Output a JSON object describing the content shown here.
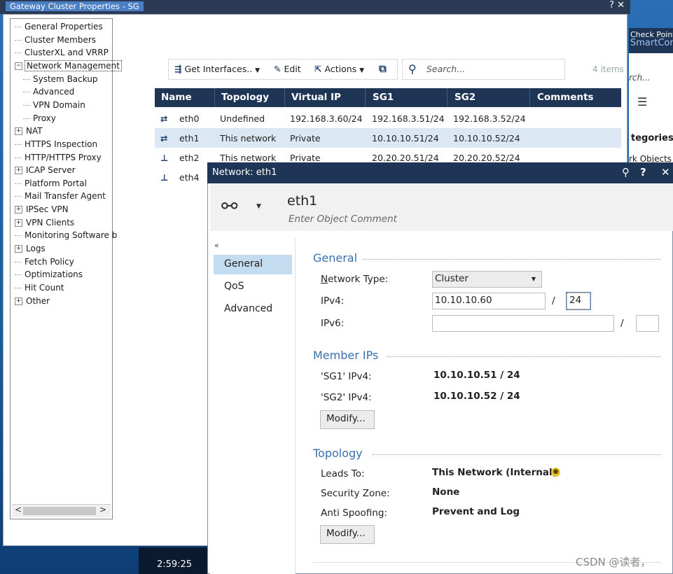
{
  "window": {
    "title": "Gateway Cluster Properties - SG",
    "title_buttons": "? ✕"
  },
  "tree": {
    "items": [
      {
        "label": "General Properties",
        "level": 0,
        "expander": ""
      },
      {
        "label": "Cluster Members",
        "level": 0,
        "expander": ""
      },
      {
        "label": "ClusterXL and VRRP",
        "level": 0,
        "expander": ""
      },
      {
        "label": "Network Management",
        "level": 0,
        "expander": "−",
        "selected": true
      },
      {
        "label": "System Backup",
        "level": 1,
        "expander": ""
      },
      {
        "label": "Advanced",
        "level": 1,
        "expander": ""
      },
      {
        "label": "VPN Domain",
        "level": 1,
        "expander": ""
      },
      {
        "label": "Proxy",
        "level": 1,
        "expander": ""
      },
      {
        "label": "NAT",
        "level": 0,
        "expander": "+"
      },
      {
        "label": "HTTPS Inspection",
        "level": 0,
        "expander": ""
      },
      {
        "label": "HTTP/HTTPS Proxy",
        "level": 0,
        "expander": ""
      },
      {
        "label": "ICAP Server",
        "level": 0,
        "expander": "+"
      },
      {
        "label": "Platform Portal",
        "level": 0,
        "expander": ""
      },
      {
        "label": "Mail Transfer Agent",
        "level": 0,
        "expander": ""
      },
      {
        "label": "IPSec VPN",
        "level": 0,
        "expander": "+"
      },
      {
        "label": "VPN Clients",
        "level": 0,
        "expander": "+"
      },
      {
        "label": "Monitoring Software b",
        "level": 0,
        "expander": ""
      },
      {
        "label": "Logs",
        "level": 0,
        "expander": "+"
      },
      {
        "label": "Fetch Policy",
        "level": 0,
        "expander": ""
      },
      {
        "label": "Optimizations",
        "level": 0,
        "expander": ""
      },
      {
        "label": "Hit Count",
        "level": 0,
        "expander": ""
      },
      {
        "label": "Other",
        "level": 0,
        "expander": "+"
      }
    ]
  },
  "toolbar": {
    "get_interfaces": "Get Interfaces..",
    "edit": "Edit",
    "actions": "Actions",
    "search_placeholder": "Search...",
    "items_count": "4 items"
  },
  "table": {
    "columns": [
      "Name",
      "Topology",
      "Virtual IP",
      "SG1",
      "SG2",
      "Comments"
    ],
    "rows": [
      {
        "name": "eth0",
        "topology": "Undefined",
        "vip": "192.168.3.60/24",
        "sg1": "192.168.3.51/24",
        "sg2": "192.168.3.52/24",
        "comments": ""
      },
      {
        "name": "eth1",
        "topology": "This network",
        "vip": "Private",
        "sg1": "10.10.10.51/24",
        "sg2": "10.10.10.52/24",
        "comments": ""
      },
      {
        "name": "eth2",
        "topology": "This network",
        "vip": "Private",
        "sg1": "20.20.20.51/24",
        "sg2": "20.20.20.52/24",
        "comments": ""
      },
      {
        "name": "eth4",
        "topology": "",
        "vip": "",
        "sg1": "",
        "sg2": "",
        "comments": ""
      }
    ]
  },
  "right_window": {
    "title_line1": "Check Point",
    "title_line2": "SmartCons",
    "search": "rch...",
    "categories": "tegories",
    "objects": "rk Objects"
  },
  "taskbar": {
    "time": "2:59:25"
  },
  "dialog": {
    "title": "Network: eth1",
    "name": "eth1",
    "comment_placeholder": "Enter Object Comment",
    "nav": [
      "General",
      "QoS",
      "Advanced"
    ],
    "general": {
      "heading": "General",
      "network_type_label": "Network Type:",
      "network_type_value": "Cluster",
      "ipv4_label": "IPv4:",
      "ipv4_value": "10.10.10.60",
      "ipv4_mask": "24",
      "ipv6_label": "IPv6:",
      "ipv6_value": "",
      "ipv6_mask": ""
    },
    "member_ips": {
      "heading": "Member IPs",
      "sg1_label": "'SG1' IPv4:",
      "sg1_value": "10.10.10.51 / 24",
      "sg2_label": "'SG2' IPv4:",
      "sg2_value": "10.10.10.52 / 24",
      "modify": "Modify..."
    },
    "topology": {
      "heading": "Topology",
      "leads_to_label": "Leads To:",
      "leads_to_value": "This Network (Internal)",
      "security_zone_label": "Security Zone:",
      "security_zone_value": "None",
      "anti_spoofing_label": "Anti Spoofing:",
      "anti_spoofing_value": "Prevent and Log",
      "modify": "Modify..."
    }
  },
  "watermark": "CSDN @读者，"
}
